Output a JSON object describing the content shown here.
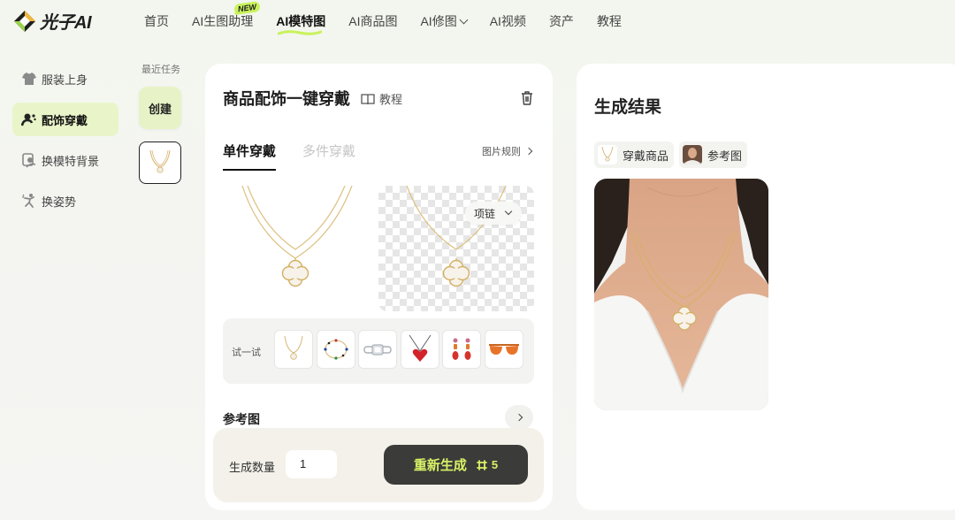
{
  "brand": {
    "name": "光子AI"
  },
  "nav": {
    "items": [
      {
        "label": "首页"
      },
      {
        "label": "AI生图助理",
        "badge": "NEW"
      },
      {
        "label": "AI模特图",
        "active": true
      },
      {
        "label": "AI商品图"
      },
      {
        "label": "AI修图",
        "has_dropdown": true
      },
      {
        "label": "AI视频"
      },
      {
        "label": "资产"
      },
      {
        "label": "教程"
      }
    ]
  },
  "sidebar": {
    "items": [
      {
        "label": "服装上身",
        "icon": "shirt-icon"
      },
      {
        "label": "配饰穿戴",
        "icon": "accessory-icon",
        "active": true
      },
      {
        "label": "换模特背景",
        "icon": "background-icon"
      },
      {
        "label": "换姿势",
        "icon": "pose-icon"
      }
    ]
  },
  "recent": {
    "title": "最近任务",
    "create_label": "创建"
  },
  "editor": {
    "title": "商品配饰一键穿戴",
    "tutorial_label": "教程",
    "tabs": [
      {
        "label": "单件穿戴",
        "active": true
      },
      {
        "label": "多件穿戴",
        "active": false
      }
    ],
    "rules_label": "图片规则",
    "category_select": "项链",
    "try_label": "试一试",
    "try_items": [
      {
        "icon": "necklace-icon"
      },
      {
        "icon": "bracelet-icon"
      },
      {
        "icon": "ring-icon"
      },
      {
        "icon": "heart-pendant-icon"
      },
      {
        "icon": "earrings-icon"
      },
      {
        "icon": "sunglasses-icon"
      }
    ],
    "reference_label": "参考图"
  },
  "generate": {
    "count_label": "生成数量",
    "count_value": "1",
    "button_label": "重新生成",
    "cost": "5"
  },
  "result": {
    "title": "生成结果",
    "chips": [
      {
        "label": "穿戴商品",
        "icon": "necklace-icon"
      },
      {
        "label": "参考图",
        "icon": "portrait-icon"
      }
    ]
  },
  "colors": {
    "accent": "#c8f25c",
    "accent_soft": "#e9f5c9",
    "button_dark": "#3b3b39",
    "button_text": "#d8f266"
  }
}
